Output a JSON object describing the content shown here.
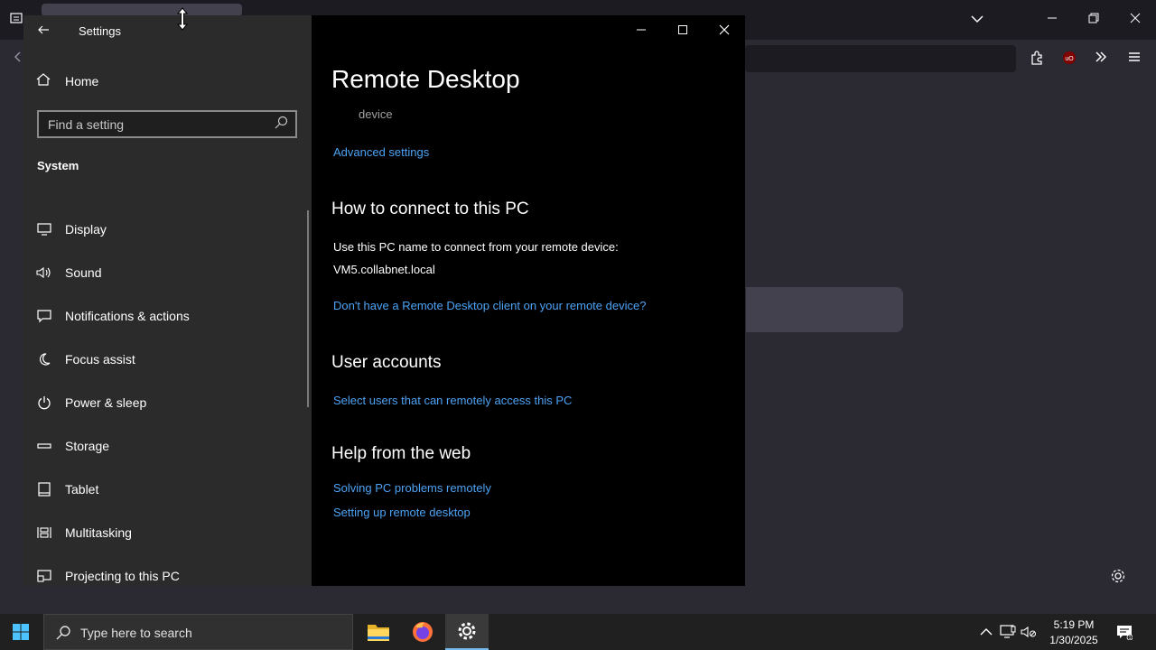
{
  "settings": {
    "title": "Settings",
    "home_label": "Home",
    "search_placeholder": "Find a setting",
    "section_label": "System",
    "nav_items": [
      {
        "label": "Display",
        "icon": "display-icon"
      },
      {
        "label": "Sound",
        "icon": "sound-icon"
      },
      {
        "label": "Notifications & actions",
        "icon": "notifications-icon"
      },
      {
        "label": "Focus assist",
        "icon": "moon-icon"
      },
      {
        "label": "Power & sleep",
        "icon": "power-icon"
      },
      {
        "label": "Storage",
        "icon": "storage-icon"
      },
      {
        "label": "Tablet",
        "icon": "tablet-icon"
      },
      {
        "label": "Multitasking",
        "icon": "multitasking-icon"
      },
      {
        "label": "Projecting to this PC",
        "icon": "projecting-icon"
      }
    ]
  },
  "remote_desktop": {
    "heading": "Remote Desktop",
    "device_label": "device",
    "advanced_link": "Advanced settings",
    "connect_heading": "How to connect to this PC",
    "connect_text": "Use this PC name to connect from your remote device:",
    "pc_name": "VM5.collabnet.local",
    "client_link": "Don't have a Remote Desktop client on your remote device?",
    "accounts_heading": "User accounts",
    "accounts_link": "Select users that can remotely access this PC",
    "help_heading": "Help from the web",
    "help_links": [
      "Solving PC problems remotely",
      "Setting up remote desktop"
    ]
  },
  "taskbar": {
    "search_placeholder": "Type here to search",
    "time": "5:19 PM",
    "date": "1/30/2025",
    "apps": [
      "file-explorer-icon",
      "firefox-icon",
      "settings-gear-icon"
    ]
  },
  "colors": {
    "link": "#4ca3f5",
    "accent": "#76b9ed"
  }
}
